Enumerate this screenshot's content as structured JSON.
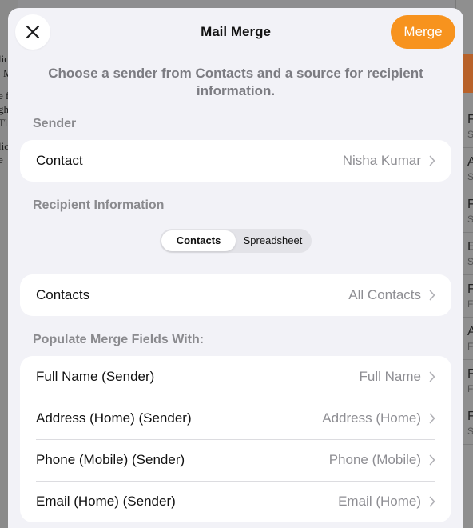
{
  "background": {
    "doc_fragments": [
      "lic",
      "M",
      "e f",
      "gh",
      "Th",
      "lic",
      "e"
    ],
    "side_rows": [
      {
        "l1": "F",
        "l2": "S"
      },
      {
        "l1": "A",
        "l2": "S"
      },
      {
        "l1": "F",
        "l2": "S"
      },
      {
        "l1": "E",
        "l2": "S"
      },
      {
        "l1": "F",
        "l2": "F"
      },
      {
        "l1": "A",
        "l2": "F"
      },
      {
        "l1": "F",
        "l2": "F"
      },
      {
        "l1": "F",
        "l2": "S"
      }
    ]
  },
  "sheet": {
    "title": "Mail Merge",
    "merge_label": "Merge",
    "subtitle": "Choose a sender from Contacts and a source for recipient information.",
    "sender": {
      "header": "Sender",
      "label": "Contact",
      "value": "Nisha Kumar"
    },
    "recipient": {
      "header": "Recipient Information",
      "segments": [
        "Contacts",
        "Spreadsheet"
      ],
      "selected_segment": "Contacts",
      "label": "Contacts",
      "value": "All Contacts"
    },
    "populate": {
      "header": "Populate Merge Fields With:",
      "rows": [
        {
          "label": "Full Name (Sender)",
          "value": "Full Name"
        },
        {
          "label": "Address (Home) (Sender)",
          "value": "Address (Home)"
        },
        {
          "label": "Phone (Mobile) (Sender)",
          "value": "Phone (Mobile)"
        },
        {
          "label": "Email (Home) (Sender)",
          "value": "Email (Home)"
        }
      ]
    }
  },
  "colors": {
    "accent": "#f7931e",
    "sheet_bg": "#f2f2f7",
    "secondary_text": "#8e8e93"
  }
}
